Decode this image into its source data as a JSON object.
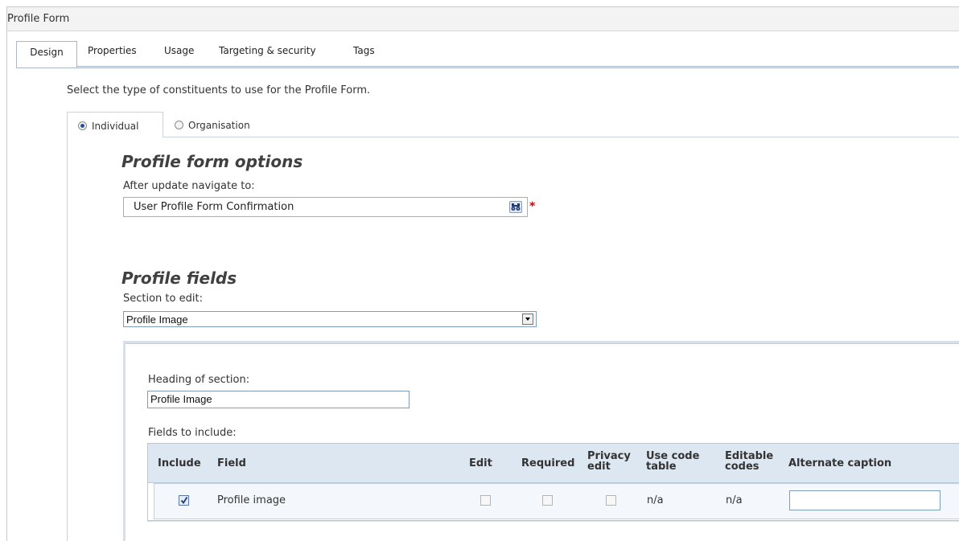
{
  "window": {
    "title": "Profile Form"
  },
  "tabs": [
    "Design",
    "Properties",
    "Usage",
    "Targeting & security",
    "Tags"
  ],
  "intro": "Select the type of constituents to use for the Profile Form.",
  "constituent_tabs": {
    "individual": "Individual",
    "organisation": "Organisation",
    "selected": "Individual"
  },
  "options": {
    "heading": "Profile form options",
    "after_update_label": "After update navigate to:",
    "after_update_value": "User Profile Form Confirmation",
    "required_marker": "*"
  },
  "fields": {
    "heading": "Profile fields",
    "section_label": "Section to edit:",
    "section_value": "Profile Image",
    "heading_label": "Heading of section:",
    "heading_value": "Profile Image",
    "include_label": "Fields to include:",
    "columns": {
      "include": "Include",
      "field": "Field",
      "edit": "Edit",
      "required": "Required",
      "privacy_line1": "Privacy",
      "privacy_line2": "edit",
      "codetable_line1": "Use code",
      "codetable_line2": "table",
      "editable_line1": "Editable",
      "editable_line2": "codes",
      "caption": "Alternate caption"
    },
    "rows": [
      {
        "include": true,
        "field": "Profile image",
        "edit": false,
        "required": false,
        "privacy_edit": false,
        "use_code_table": "n/a",
        "editable_codes": "n/a",
        "alternate_caption": ""
      }
    ]
  },
  "colors": {
    "accent_border": "#a9b7c6",
    "header_bg": "#dde7f1",
    "required": "#d40000"
  },
  "icons": {
    "lookup": "binoculars-icon",
    "dropdown": "chevron-down-icon",
    "checkbox": "checkmark-icon"
  }
}
